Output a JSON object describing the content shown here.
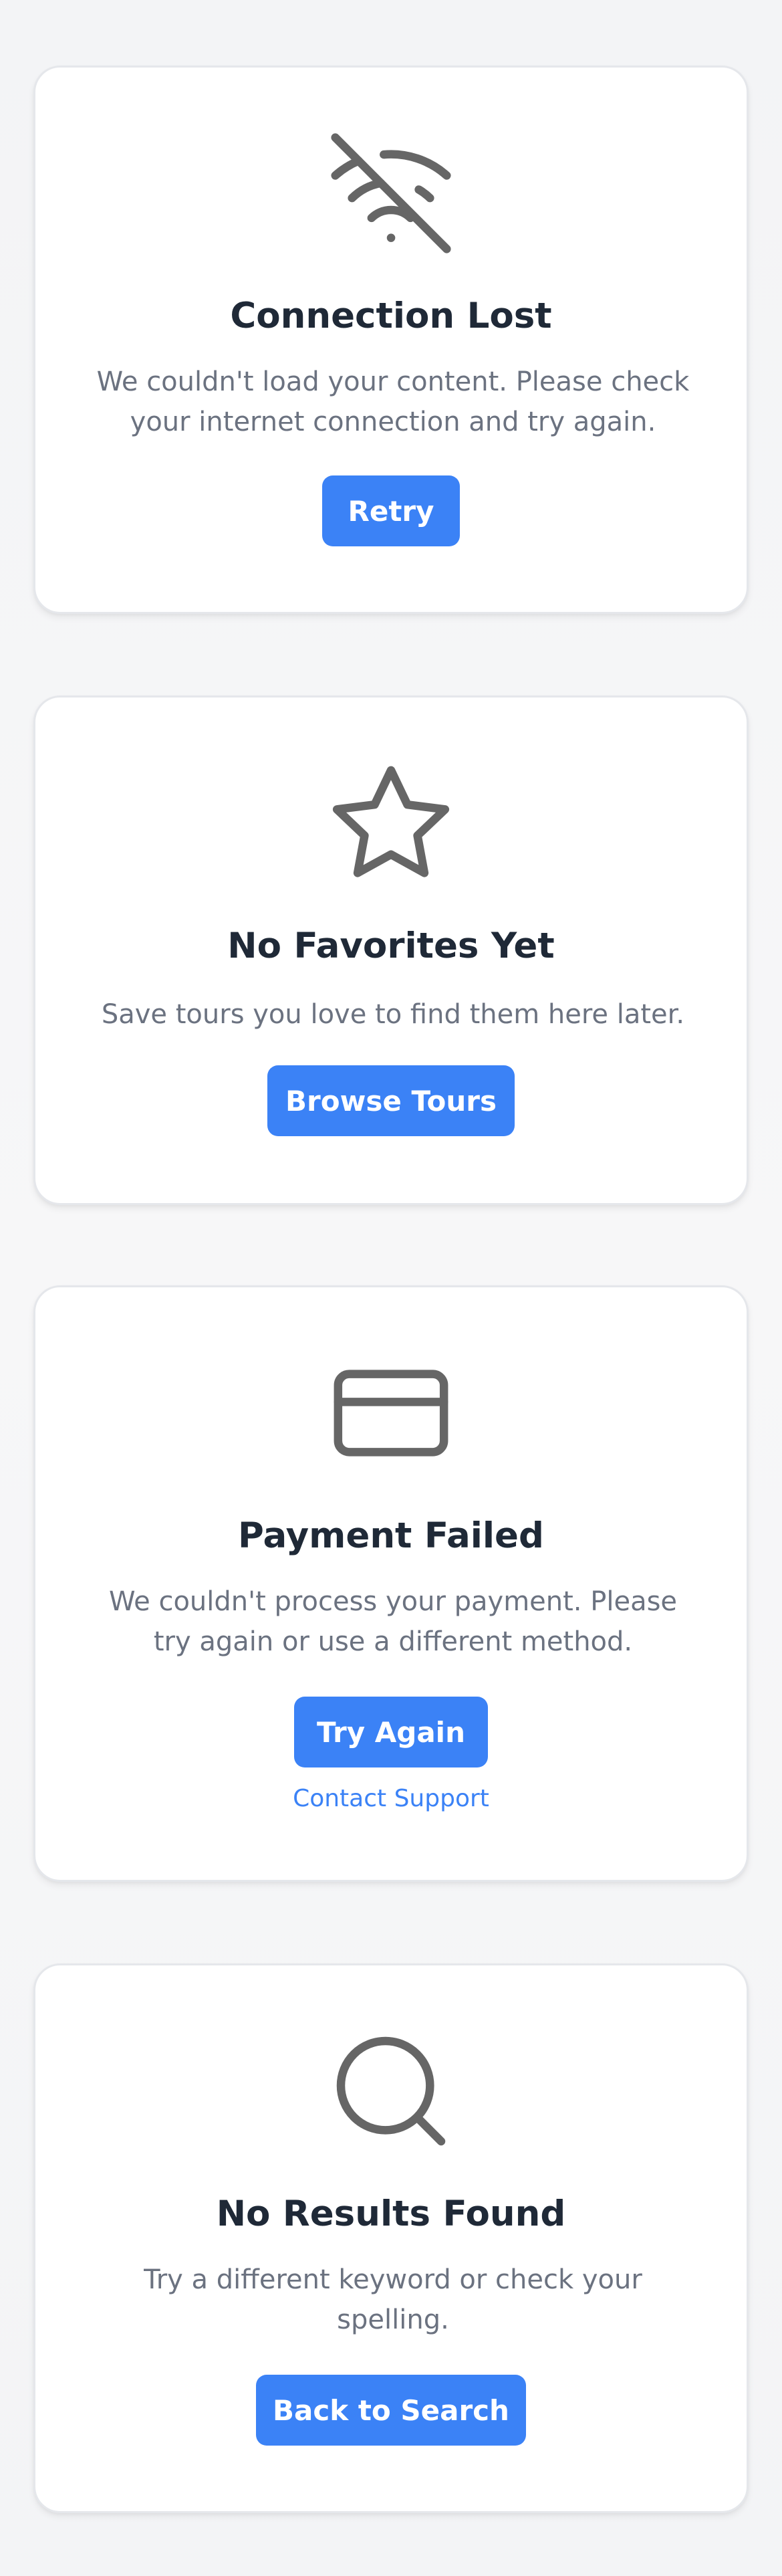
{
  "cards": {
    "connection": {
      "icon": "wifi-off-icon",
      "title": "Connection Lost",
      "description": "We couldn't load your content. Please check your internet connection and try again.",
      "primary_button": "Retry"
    },
    "favorites": {
      "icon": "star-icon",
      "title": "No Favorites Yet",
      "description": "Save tours you love to find them here later.",
      "primary_button": "Browse Tours"
    },
    "payment": {
      "icon": "credit-card-icon",
      "title": "Payment Failed",
      "description": "We couldn't process your payment. Please try again or use a different method.",
      "primary_button": "Try Again",
      "secondary_link": "Contact Support"
    },
    "search": {
      "icon": "search-icon",
      "title": "No Results Found",
      "description": "Try a different keyword or check your spelling.",
      "primary_button": "Back to Search"
    }
  },
  "colors": {
    "accent": "#3b82f6",
    "title": "#1f2937",
    "body_text": "#6b7280",
    "icon": "#666666",
    "card_border": "#e5e7eb"
  }
}
